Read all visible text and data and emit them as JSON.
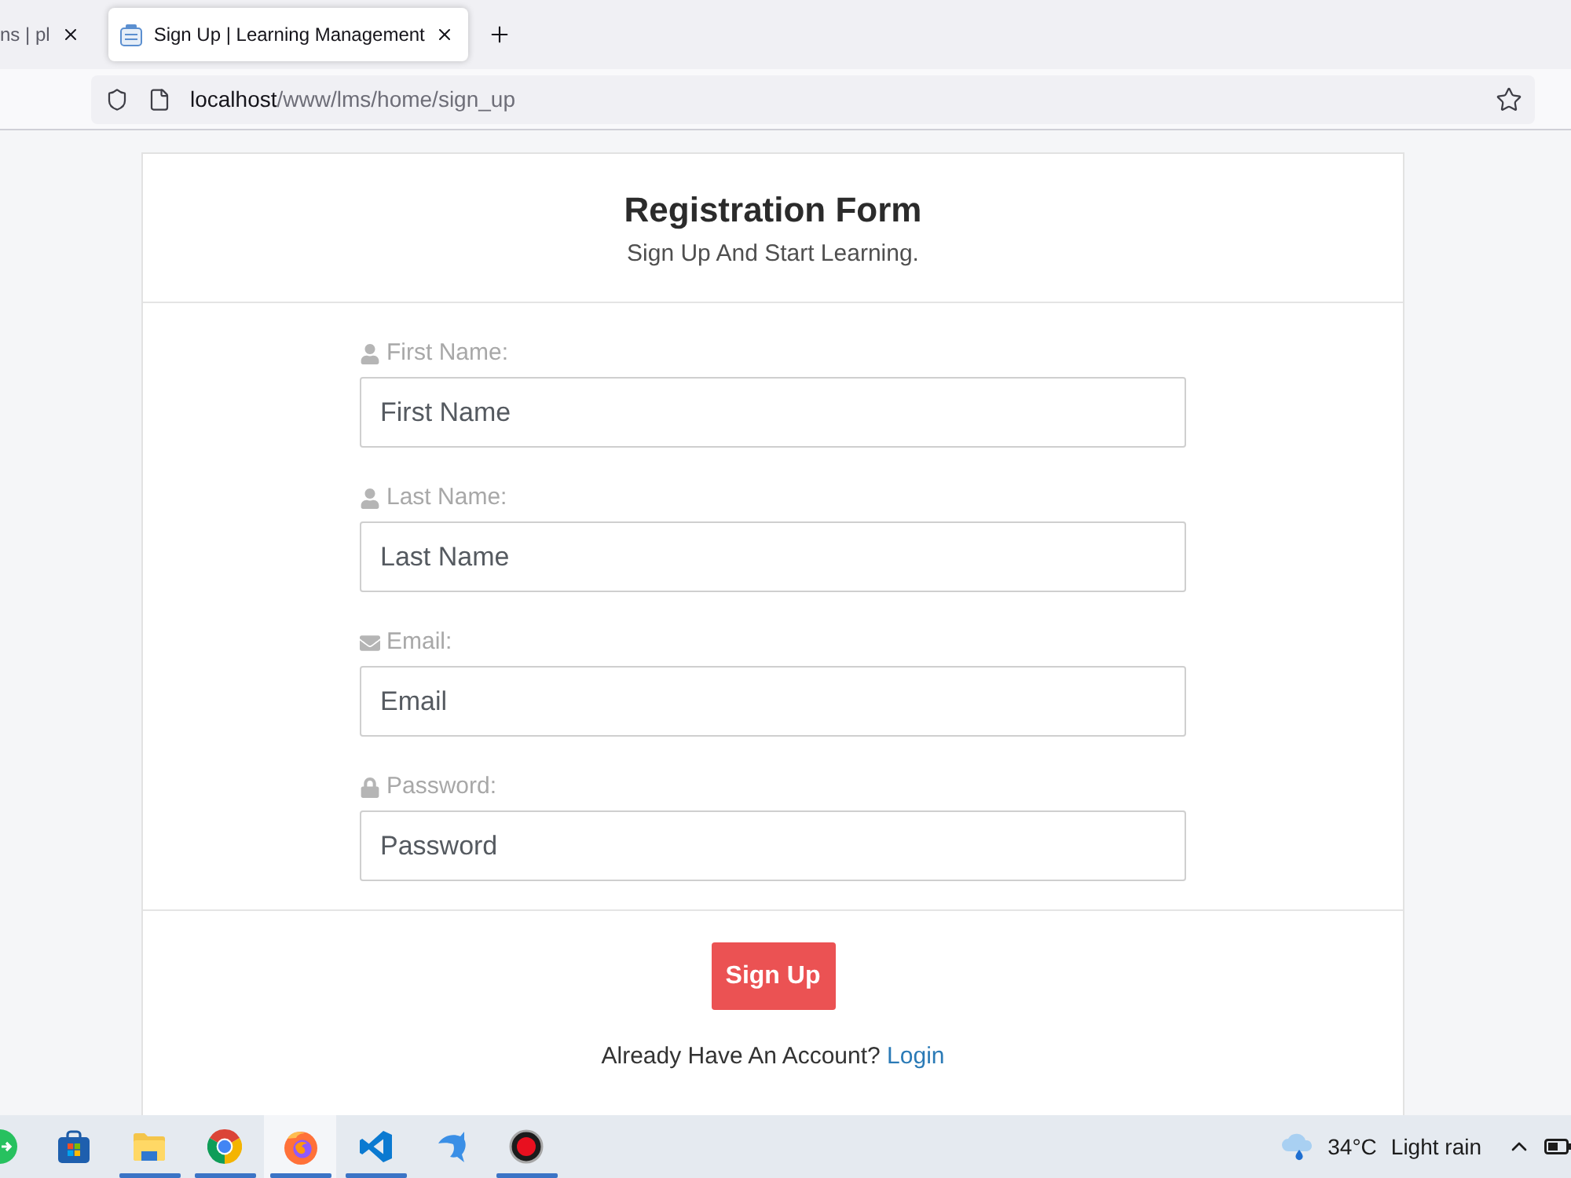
{
  "browser": {
    "tabs": [
      {
        "title": "ns | pl",
        "selected": false
      },
      {
        "title": "Sign Up | Learning Management",
        "selected": true
      }
    ],
    "address": {
      "host": "localhost",
      "path": "/www/lms/home/sign_up"
    }
  },
  "form": {
    "title": "Registration Form",
    "subtitle": "Sign Up And Start Learning.",
    "fields": [
      {
        "kind": "user",
        "label": "First Name:",
        "placeholder": "First Name"
      },
      {
        "kind": "user",
        "label": "Last Name:",
        "placeholder": "Last Name"
      },
      {
        "kind": "email",
        "label": "Email:",
        "placeholder": "Email"
      },
      {
        "kind": "password",
        "label": "Password:",
        "placeholder": "Password"
      }
    ],
    "submit": "Sign Up",
    "prompt": {
      "text": "Already Have An Account?",
      "link": "Login"
    }
  },
  "taskbar": {
    "apps": [
      {
        "kind": "chat",
        "running": false,
        "selected": false
      },
      {
        "kind": "store",
        "running": false,
        "selected": false
      },
      {
        "kind": "folder",
        "running": true,
        "selected": false
      },
      {
        "kind": "chrome",
        "running": true,
        "selected": false
      },
      {
        "kind": "firefox",
        "running": true,
        "selected": true
      },
      {
        "kind": "code",
        "running": true,
        "selected": false
      },
      {
        "kind": "dolphin",
        "running": false,
        "selected": false
      },
      {
        "kind": "record",
        "running": true,
        "selected": false
      }
    ],
    "weather": {
      "temperature": "34°C",
      "condition": "Light rain"
    }
  }
}
